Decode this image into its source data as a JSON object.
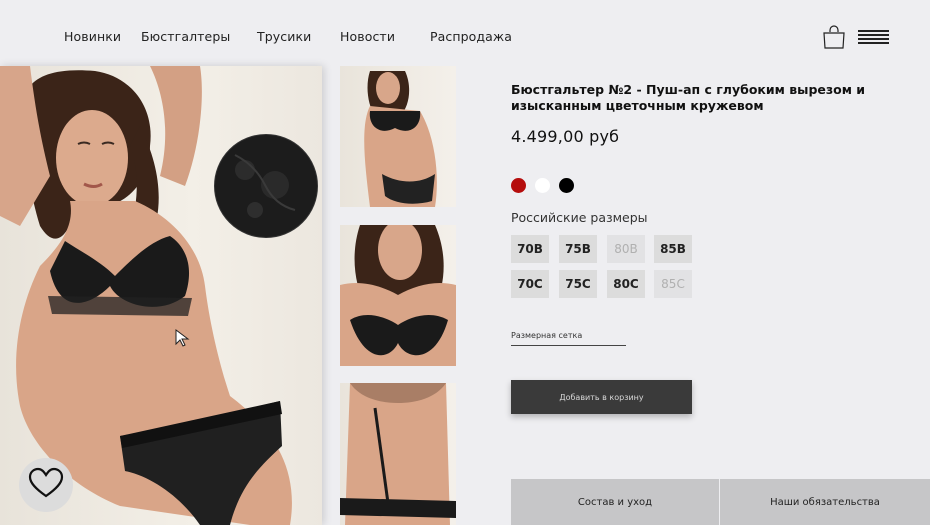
{
  "nav": {
    "items": [
      {
        "label": "Новинки"
      },
      {
        "label": "Бюстгалтеры"
      },
      {
        "label": "Трусики"
      },
      {
        "label": "Новости"
      },
      {
        "label": "Распродажа"
      }
    ],
    "icons": {
      "bag": "shopping-bag-icon",
      "menu": "hamburger-menu-icon"
    }
  },
  "gallery": {
    "main_image": "model-photo-black-lace-lingerie",
    "thumbnails": [
      "front-view-photo",
      "closeup-bra-photo",
      "back-view-photo"
    ],
    "favorite_icon": "heart-icon"
  },
  "product": {
    "title": "Бюстгальтер №2 - Пуш-ап с глубоким вырезом и изысканным цветочным кружевом",
    "price": "4.499,00 руб",
    "colors": [
      {
        "name": "red",
        "hex": "#b50d0d"
      },
      {
        "name": "white",
        "hex": "#ffffff"
      },
      {
        "name": "black",
        "hex": "#000000"
      }
    ],
    "sizes_label": "Российские размеры",
    "sizes": [
      {
        "label": "70B",
        "available": true
      },
      {
        "label": "75B",
        "available": true
      },
      {
        "label": "80B",
        "available": false
      },
      {
        "label": "85B",
        "available": true
      },
      {
        "label": "70C",
        "available": true
      },
      {
        "label": "75C",
        "available": true
      },
      {
        "label": "80C",
        "available": true
      },
      {
        "label": "85C",
        "available": false
      }
    ],
    "size_chart_label": "Размерная сетка",
    "add_to_cart_label": "Добавить в корзину"
  },
  "tabs": [
    {
      "label": "Состав и уход"
    },
    {
      "label": "Наши обязательства"
    }
  ]
}
